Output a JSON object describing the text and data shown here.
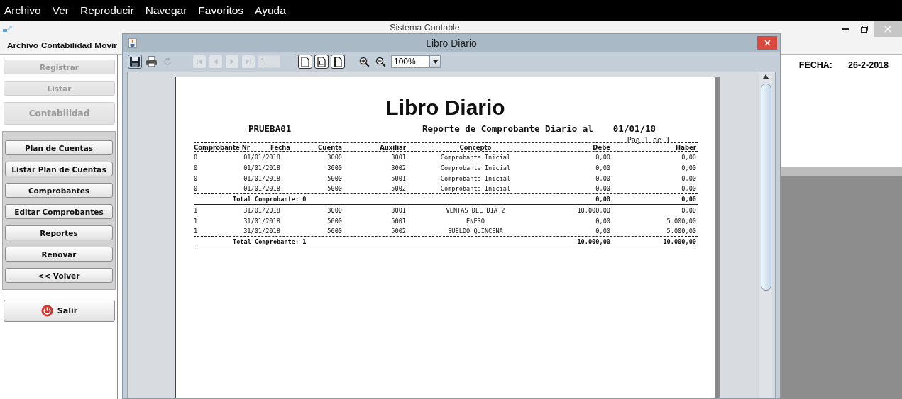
{
  "top_menu": [
    "Archivo",
    "Ver",
    "Reproducir",
    "Navegar",
    "Favoritos",
    "Ayuda"
  ],
  "main_window": {
    "title": "Sistema Contable",
    "menu": [
      "Archivo",
      "Contabilidad",
      "Movir"
    ],
    "top_buttons": [
      {
        "label": "Registrar",
        "disabled": true,
        "kind": "small"
      },
      {
        "label": "Listar",
        "disabled": true,
        "kind": "small"
      },
      {
        "label": "Contabilidad",
        "disabled": true,
        "kind": "large"
      }
    ],
    "group_buttons": [
      {
        "label": "Plan de Cuentas",
        "disabled": false
      },
      {
        "label": "Listar Plan de Cuentas",
        "disabled": false
      },
      {
        "label": "Comprobantes",
        "disabled": false
      },
      {
        "label": "Editar Comprobantes",
        "disabled": false
      },
      {
        "label": "Reportes",
        "disabled": false
      },
      {
        "label": "Renovar",
        "disabled": false
      },
      {
        "label": "<< Volver",
        "disabled": false
      }
    ],
    "exit_button": {
      "label": "Salir"
    },
    "date_label": "FECHA:",
    "date_value": "26-2-2018"
  },
  "dialog": {
    "title": "Libro Diario",
    "toolbar": [
      {
        "kind": "save",
        "disabled": false
      },
      {
        "kind": "print",
        "disabled": false
      },
      {
        "kind": "reload",
        "disabled": true
      },
      {
        "kind": "first",
        "disabled": true
      },
      {
        "kind": "previous",
        "disabled": true
      },
      {
        "kind": "next",
        "disabled": true
      },
      {
        "kind": "last",
        "disabled": true
      },
      {
        "kind": "page",
        "disabled": true,
        "value": "1"
      },
      {
        "kind": "actual_size",
        "disabled": false
      },
      {
        "kind": "fit_page",
        "disabled": false
      },
      {
        "kind": "fit_width",
        "disabled": false
      },
      {
        "kind": "zoom_in",
        "disabled": false
      },
      {
        "kind": "zoom_out",
        "disabled": false
      },
      {
        "kind": "zoom",
        "disabled": false,
        "value": "100%"
      }
    ]
  },
  "report": {
    "title": "Libro Diario",
    "company": "PRUEBA01",
    "subtitle": "Reporte de Comprobante Diario al",
    "date": "01/01/18",
    "page_label": "Pag 1 de 1",
    "columns": [
      "Comprobante Nr",
      "Fecha",
      "Cuenta",
      "Auxiliar",
      "Concepto",
      "Debe",
      "Haber"
    ],
    "groups": [
      {
        "rows": [
          [
            "0",
            "01/01/2018",
            "3000",
            "3001",
            "Comprobante Inicial",
            "0,00",
            "0,00"
          ],
          [
            "0",
            "01/01/2018",
            "3000",
            "3002",
            "Comprobante Inicial",
            "0,00",
            "0,00"
          ],
          [
            "0",
            "01/01/2018",
            "5000",
            "5001",
            "Comprobante Inicial",
            "0,00",
            "0,00"
          ],
          [
            "0",
            "01/01/2018",
            "5000",
            "5002",
            "Comprobante Inicial",
            "0,00",
            "0,00"
          ]
        ],
        "total_label": "Total Comprobante: 0",
        "total_debe": "0,00",
        "total_haber": "0,00"
      },
      {
        "rows": [
          [
            "1",
            "31/01/2018",
            "3000",
            "3001",
            "VENTAS DEL DIA 2",
            "10.000,00",
            "0,00"
          ],
          [
            "1",
            "31/01/2018",
            "5000",
            "5001",
            "ENERO",
            "0,00",
            "5.000,00"
          ],
          [
            "1",
            "31/01/2018",
            "5000",
            "5002",
            "SUELDO QUINCENA",
            "0,00",
            "5.000,00"
          ]
        ],
        "total_label": "Total Comprobante: 1",
        "total_debe": "10.000,00",
        "total_haber": "10.000,00"
      }
    ]
  }
}
